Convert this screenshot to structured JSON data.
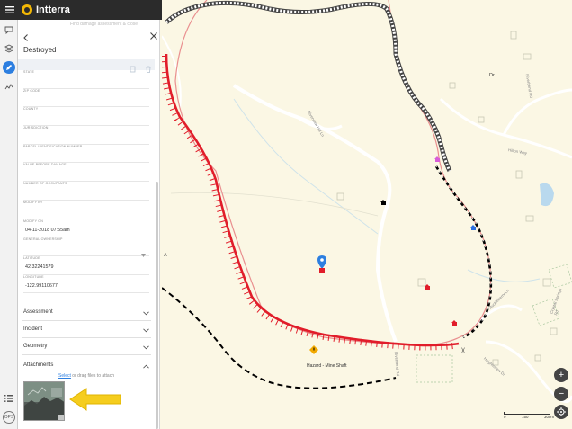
{
  "app": {
    "brand": "Intterra"
  },
  "rail": {
    "items": [
      {
        "icon": "message-icon"
      },
      {
        "icon": "layers-icon"
      },
      {
        "icon": "pencil-icon"
      },
      {
        "icon": "analytics-icon"
      }
    ],
    "bottom": {
      "list_icon": "list-icon",
      "ops_label": "OPS"
    }
  },
  "panel": {
    "ghost_title": "Find damage assessment & close",
    "title": "Destroyed",
    "fields": [
      {
        "label": "STATE",
        "value": ""
      },
      {
        "label": "ZIP CODE",
        "value": ""
      },
      {
        "label": "COUNTY",
        "value": ""
      },
      {
        "label": "JURISDICTION",
        "value": ""
      },
      {
        "label": "PARCEL IDENTIFICATION NUMBER",
        "value": ""
      },
      {
        "label": "VALUE BEFORE DAMAGE",
        "value": ""
      },
      {
        "label": "NUMBER OF OCCUPANTS",
        "value": ""
      },
      {
        "label": "MODIFY BY",
        "value": ""
      },
      {
        "label": "MODIFY ON",
        "value": "04-11-2018 07:55am"
      },
      {
        "label": "GENERAL OWNERSHIP",
        "value": ""
      },
      {
        "label": "LATITUDE",
        "value": "42.32241579"
      },
      {
        "label": "LONGITUDE",
        "value": "-122.99110677"
      }
    ],
    "sections": [
      {
        "label": "Assessment"
      },
      {
        "label": "Incident"
      },
      {
        "label": "Geometry"
      }
    ],
    "attachments": {
      "label": "Attachments",
      "hint_select": "Select",
      "hint_rest": " or drag files to attach"
    }
  },
  "map": {
    "labels": {
      "hazard": "Hazard - Mine Shaft",
      "dr": "Dr",
      "a": "A",
      "paren": ")("
    },
    "street_labels": [
      {
        "text": "Riverbend Rd"
      },
      {
        "text": "Riverview Hill Ln"
      },
      {
        "text": "Hilton Way"
      },
      {
        "text": "Huckleberry Ln"
      },
      {
        "text": "Crystal Springs Rd"
      },
      {
        "text": "Riverbend Rd"
      },
      {
        "text": "Heightsview Dr"
      }
    ],
    "scale": {
      "labels": [
        "0",
        "150",
        "300m"
      ]
    },
    "controls": {
      "zoom_in": "+",
      "zoom_out": "−",
      "locate_icon": "locate-icon"
    },
    "colors": {
      "fire_line": "#e11d2a",
      "road": "#ffffff",
      "trail": "#e98f8f"
    }
  }
}
